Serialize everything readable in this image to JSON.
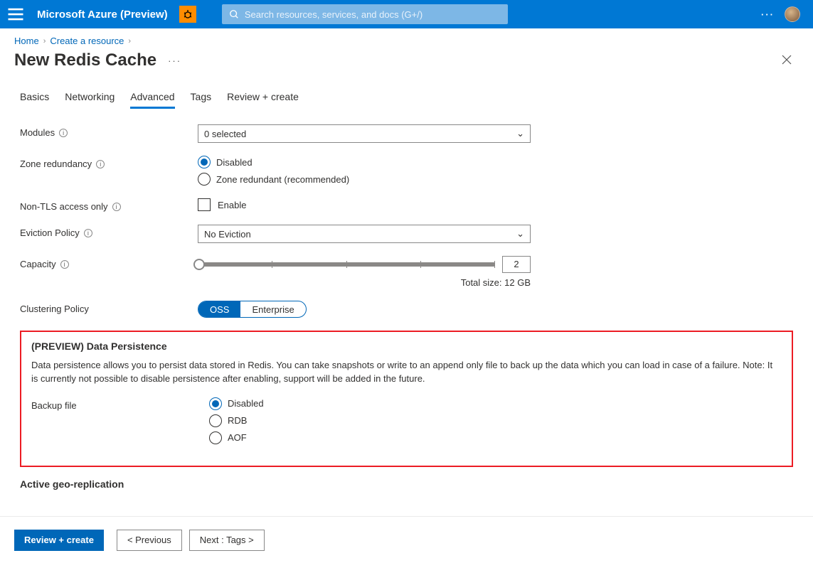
{
  "header": {
    "brand": "Microsoft Azure (Preview)",
    "search_placeholder": "Search resources, services, and docs (G+/)"
  },
  "breadcrumb": {
    "home": "Home",
    "create": "Create a resource"
  },
  "page": {
    "title": "New Redis Cache"
  },
  "tabs": {
    "basics": "Basics",
    "networking": "Networking",
    "advanced": "Advanced",
    "tags": "Tags",
    "review": "Review + create"
  },
  "form": {
    "modules_label": "Modules",
    "modules_value": "0 selected",
    "zone_label": "Zone redundancy",
    "zone_disabled": "Disabled",
    "zone_recommended": "Zone redundant (recommended)",
    "nontls_label": "Non-TLS access only",
    "nontls_enable": "Enable",
    "eviction_label": "Eviction Policy",
    "eviction_value": "No Eviction",
    "capacity_label": "Capacity",
    "capacity_value": "2",
    "total_size": "Total size: 12 GB",
    "clustering_label": "Clustering Policy",
    "clustering_oss": "OSS",
    "clustering_enterprise": "Enterprise"
  },
  "persistence": {
    "heading": "(PREVIEW) Data Persistence",
    "desc": "Data persistence allows you to persist data stored in Redis. You can take snapshots or write to an append only file to back up the data which you can load in case of a failure. Note: It is currently not possible to disable persistence after enabling, support will be added in the future.",
    "backup_label": "Backup file",
    "opt_disabled": "Disabled",
    "opt_rdb": "RDB",
    "opt_aof": "AOF"
  },
  "geo": {
    "heading": "Active geo-replication"
  },
  "footer": {
    "review": "Review + create",
    "previous": "<  Previous",
    "next": "Next : Tags  >"
  }
}
